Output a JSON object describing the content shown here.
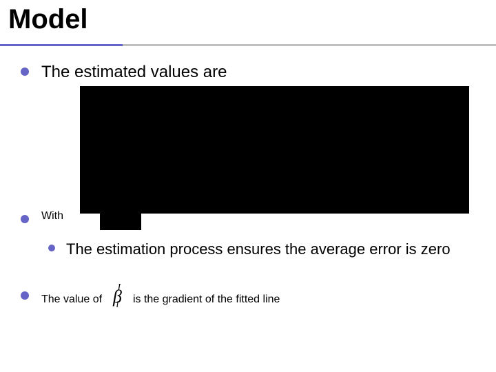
{
  "title": "Model",
  "b1": {
    "text": "The estimated values are"
  },
  "b2": {
    "text": "With"
  },
  "b2_sub": {
    "text": "The estimation process ensures the average error is zero"
  },
  "b3": {
    "prefix": "The value of ",
    "math_base": "β",
    "math_sup": "I",
    "math_sub": "i",
    "suffix": " is the gradient of the fitted line"
  }
}
